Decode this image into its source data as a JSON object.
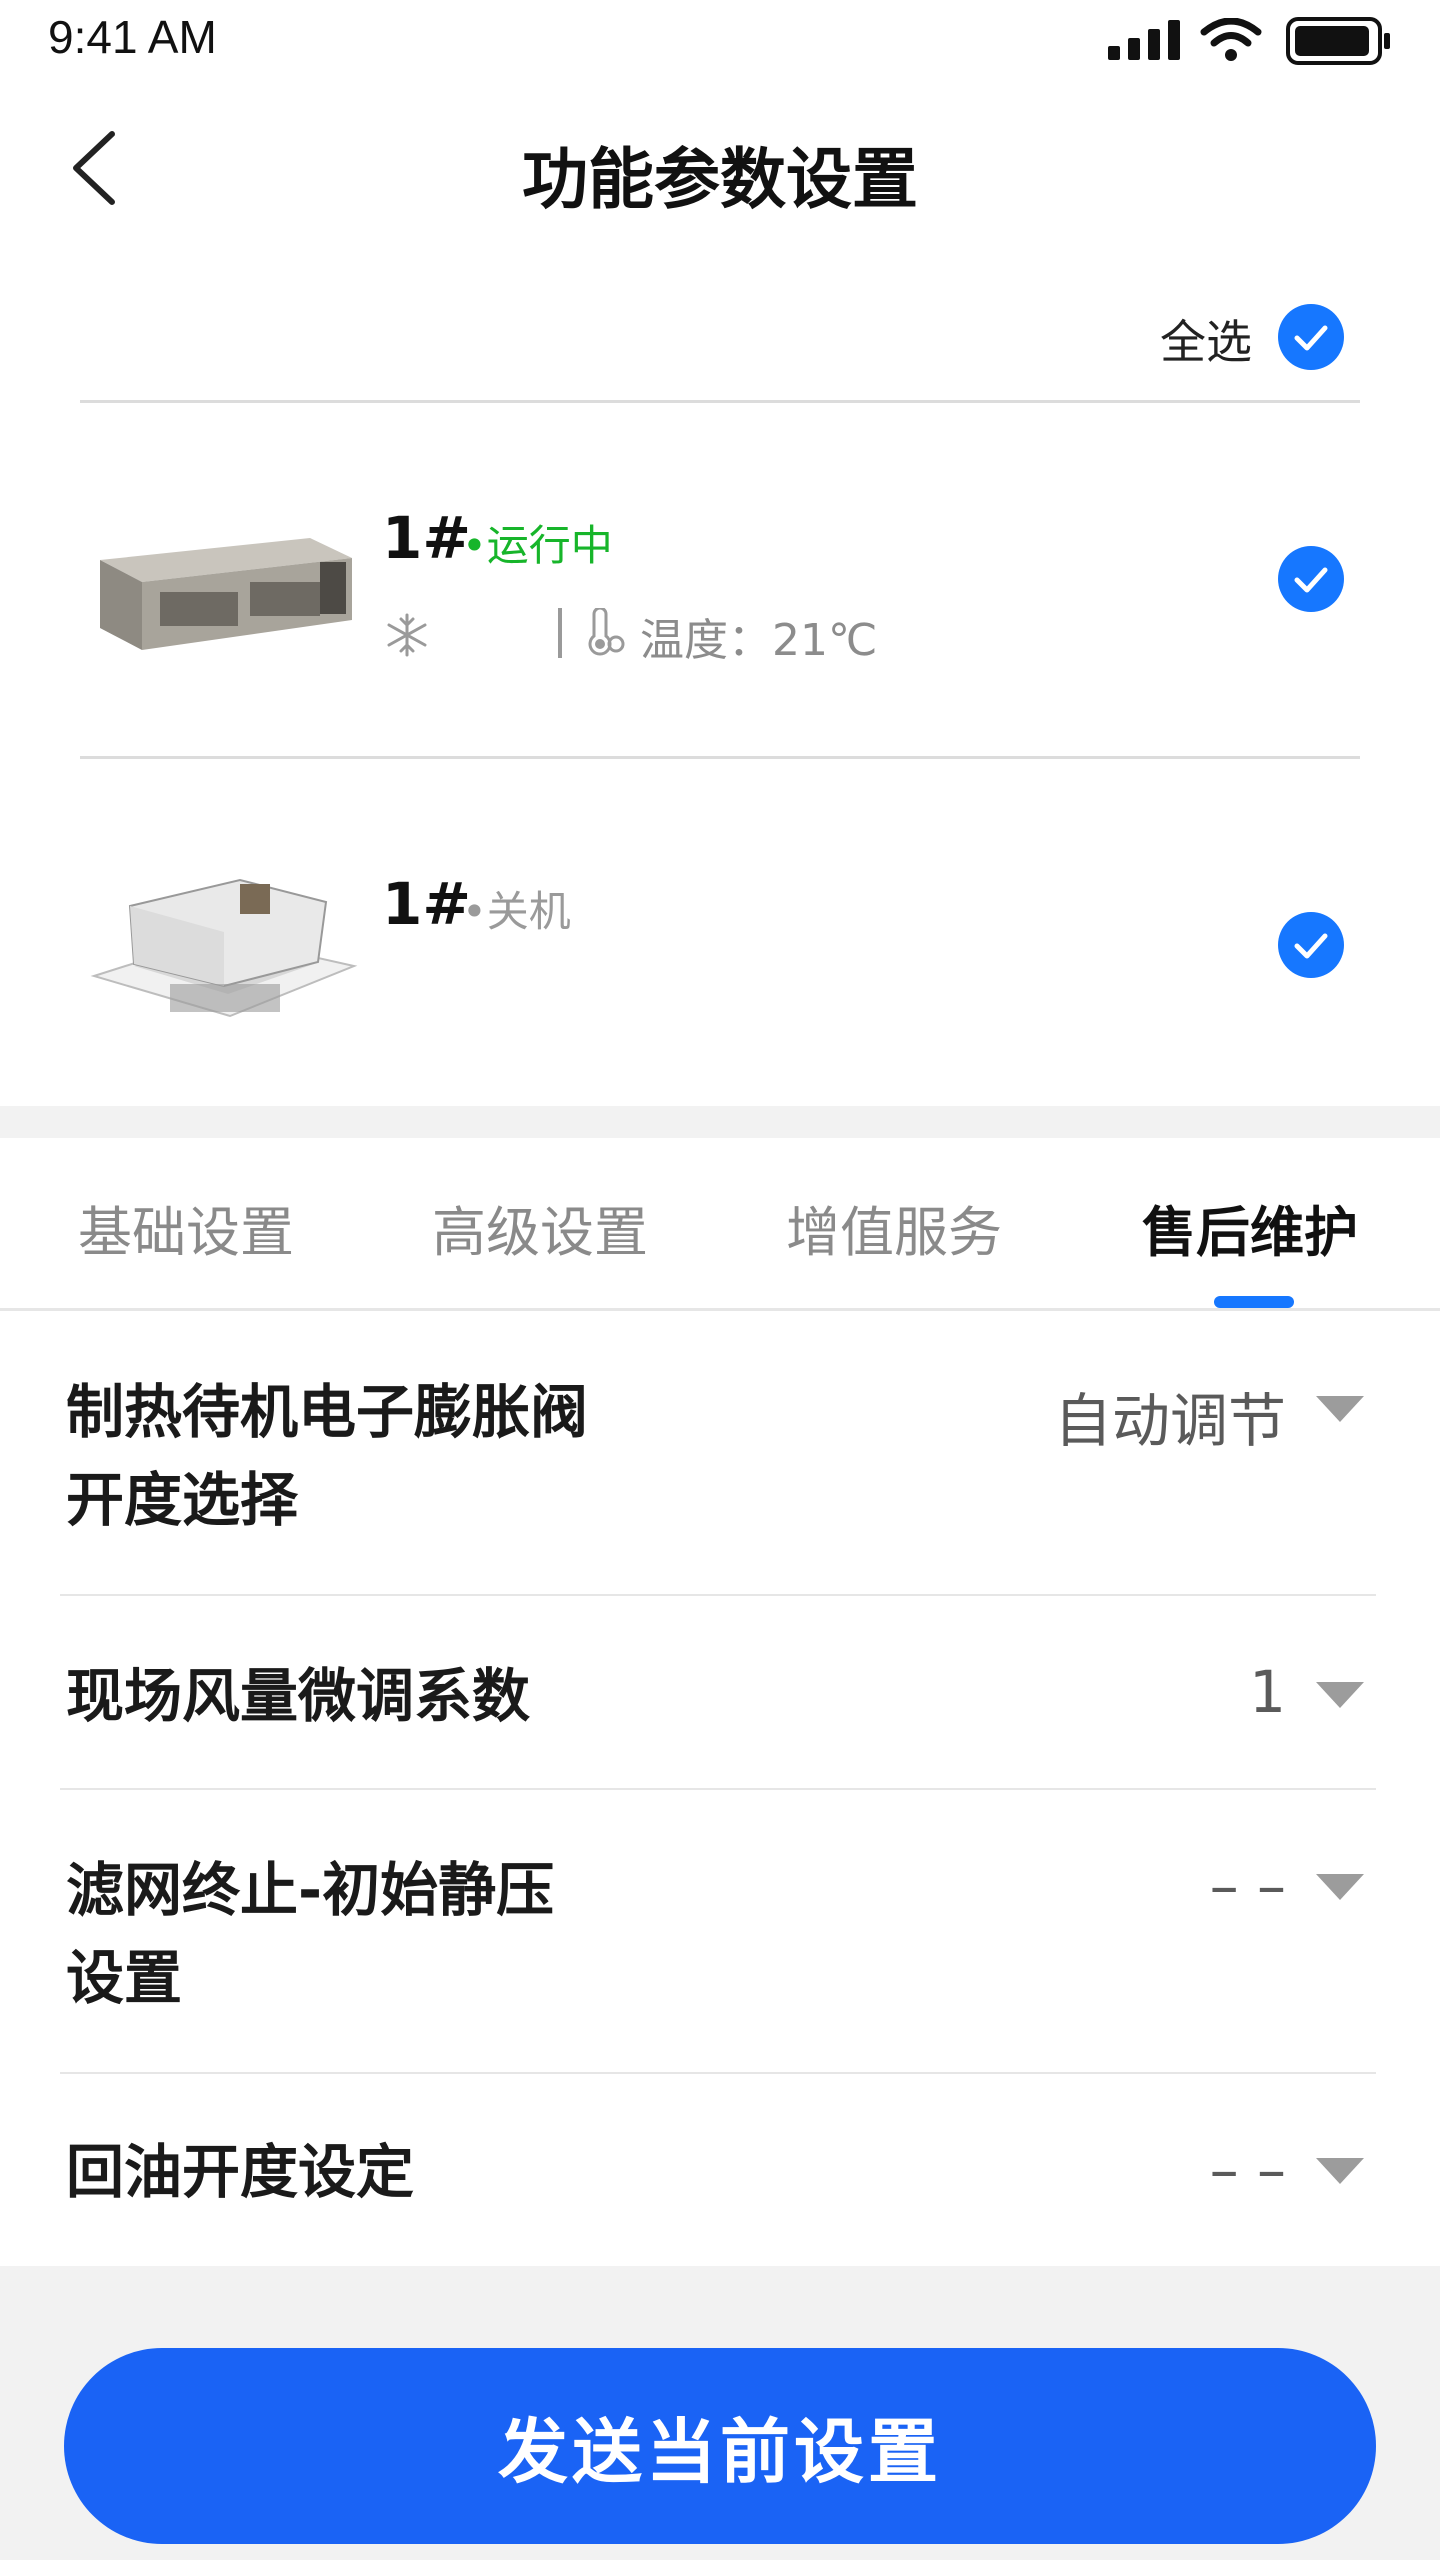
{
  "status_bar": {
    "time": "9:41 AM"
  },
  "nav": {
    "title": "功能参数设置"
  },
  "select_all": {
    "label": "全选",
    "checked": true
  },
  "devices": [
    {
      "name": "1#",
      "status": "•运行中",
      "mode_icon": "snowflake-icon",
      "temp_label": "温度：21℃",
      "checked": true
    },
    {
      "name": "1#",
      "status": "•关机",
      "checked": true
    }
  ],
  "tabs": [
    {
      "label": "基础设置",
      "active": false
    },
    {
      "label": "高级设置",
      "active": false
    },
    {
      "label": "增值服务",
      "active": false
    },
    {
      "label": "售后维护",
      "active": true
    }
  ],
  "settings": [
    {
      "label_lines": [
        "制热待机电子膨胀阀",
        "开度选择"
      ],
      "value": "自动调节"
    },
    {
      "label_lines": [
        "现场风量微调系数"
      ],
      "value": "1"
    },
    {
      "label_lines": [
        "滤网终止-初始静压",
        "设置"
      ],
      "value": "– –"
    },
    {
      "label_lines": [
        "回油开度设定"
      ],
      "value": "– –"
    }
  ],
  "send_button": {
    "label": "发送当前设置"
  },
  "colors": {
    "accent": "#1677ff",
    "button": "#1a63f5",
    "running": "#17b52a"
  }
}
